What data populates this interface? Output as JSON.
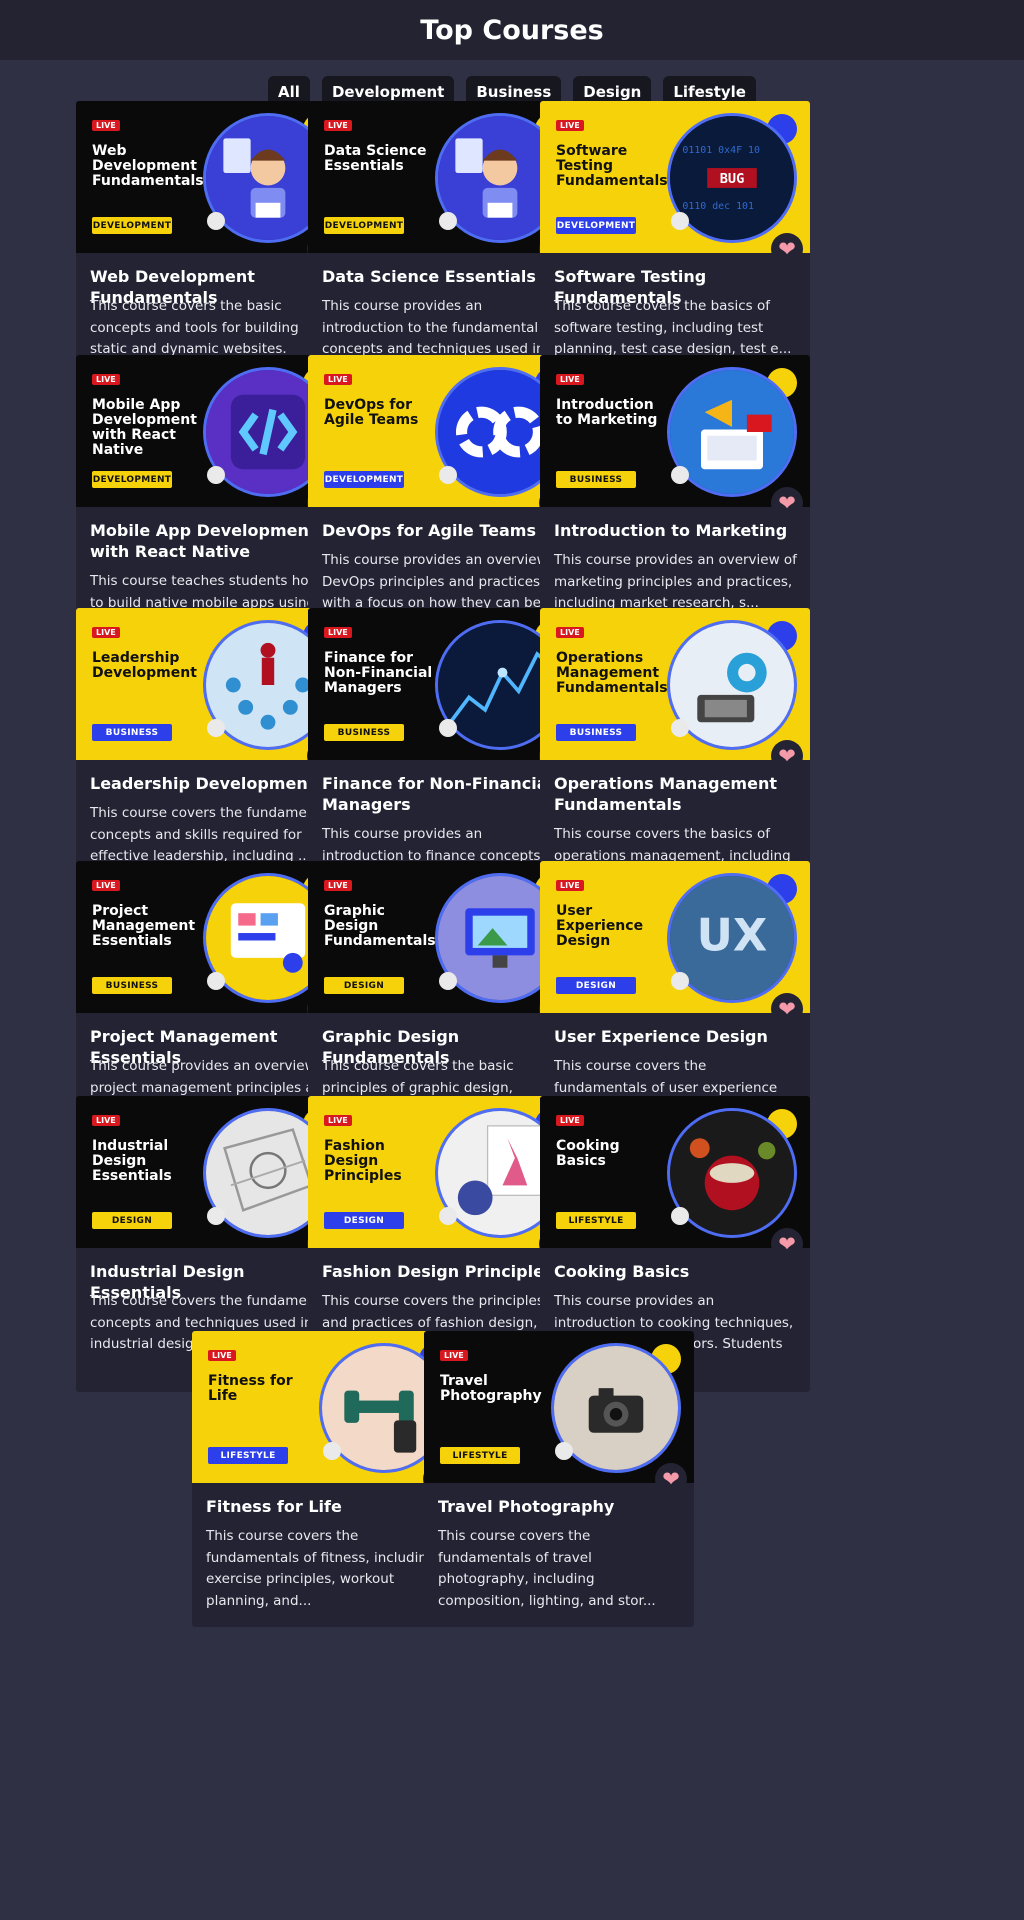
{
  "header": {
    "title": "Top Courses"
  },
  "filters": [
    "All",
    "Development",
    "Business",
    "Design",
    "Lifestyle"
  ],
  "live_label": "LIVE",
  "colors": {
    "yellow": "#f6d20a",
    "blue": "#2d3fea",
    "card_bg": "#232333",
    "page_bg": "#2f3044",
    "heart": "#f49aa8"
  },
  "courses": [
    {
      "banner_title": "Web Development Fundamentals",
      "tag": "DEVELOPMENT",
      "title": "Web Development Fundamentals",
      "description": "This course covers the basic concepts and tools for building static and dynamic websites. Students w...",
      "banner_theme": "dark",
      "image": "developer-illustration-icon"
    },
    {
      "banner_title": "Data Science Essentials",
      "tag": "DEVELOPMENT",
      "title": "Data Science Essentials",
      "description": "This course provides an introduction to the fundamental concepts and techniques used in data science...",
      "banner_theme": "dark",
      "image": "developer-illustration-icon"
    },
    {
      "banner_title": "Software Testing Fundamentals",
      "tag": "DEVELOPMENT",
      "title": "Software Testing Fundamentals",
      "description": "This course covers the basics of software testing, including test planning, test case design, test e...",
      "banner_theme": "yellow",
      "image": "bug-code-icon"
    },
    {
      "banner_title": "Mobile App Development with React Native",
      "tag": "DEVELOPMENT",
      "title": "Mobile App Development with React Native",
      "description": "This course teaches students how to build native mobile apps using the React Native framework. Stude...",
      "banner_theme": "dark",
      "image": "code-brackets-icon"
    },
    {
      "banner_title": "DevOps for Agile Teams",
      "tag": "DEVELOPMENT",
      "title": "DevOps for Agile Teams",
      "description": "This course provides an overview of DevOps principles and practices, with a focus on how they can be...",
      "banner_theme": "yellow",
      "image": "infinity-loop-icon"
    },
    {
      "banner_title": "Introduction to Marketing",
      "tag": "BUSINESS",
      "title": "Introduction to Marketing",
      "description": "This course provides an overview of marketing principles and practices, including market research, s...",
      "banner_theme": "dark",
      "image": "marketing-megaphone-icon"
    },
    {
      "banner_title": "Leadership Development",
      "tag": "BUSINESS",
      "title": "Leadership Development",
      "description": "This course covers the fundamental concepts and skills required for effective leadership, including ...",
      "banner_theme": "yellow",
      "image": "leader-crowd-icon"
    },
    {
      "banner_title": "Finance for Non-Financial Managers",
      "tag": "BUSINESS",
      "title": "Finance for Non-Financial Managers",
      "description": "This course provides an introduction to finance concepts and tools for non-financial managers. Stude...",
      "banner_theme": "dark",
      "image": "finance-chart-icon"
    },
    {
      "banner_title": "Operations Management Fundamentals",
      "tag": "BUSINESS",
      "title": "Operations Management Fundamentals",
      "description": "This course covers the basics of operations management, including process design, capacity planning,...",
      "banner_theme": "yellow",
      "image": "operations-gears-icon"
    },
    {
      "banner_title": "Project Management Essentials",
      "tag": "BUSINESS",
      "title": "Project Management Essentials",
      "description": "This course provides an overview of project management principles and techniques, including project ...",
      "banner_theme": "dark",
      "image": "project-board-icon"
    },
    {
      "banner_title": "Graphic Design Fundamentals",
      "tag": "DESIGN",
      "title": "Graphic Design Fundamentals",
      "description": "This course covers the basic principles of graphic design, including typography, color theory, layou...",
      "banner_theme": "dark",
      "image": "design-monitor-icon"
    },
    {
      "banner_title": "User Experience Design",
      "tag": "DESIGN",
      "title": "User Experience Design",
      "description": "This course covers the fundamentals of user experience (UX) design, including user research, interac...",
      "banner_theme": "yellow",
      "image": "ux-letters-icon"
    },
    {
      "banner_title": "Industrial Design Essentials",
      "tag": "DESIGN",
      "title": "Industrial Design Essentials",
      "description": "This course covers the fundamental concepts and techniques used in industrial design, including sket...",
      "banner_theme": "dark",
      "image": "blueprint-sketch-icon"
    },
    {
      "banner_title": "Fashion Design Principles",
      "tag": "DESIGN",
      "title": "Fashion Design Principles",
      "description": "This course covers the principles and practices of fashion design, including fashion illustration, t...",
      "banner_theme": "yellow",
      "image": "fashion-sketch-icon"
    },
    {
      "banner_title": "Cooking Basics",
      "tag": "LIFESTYLE",
      "title": "Cooking Basics",
      "description": "This course provides an introduction to cooking techniques, ingredients, and flavors. Students will ...",
      "banner_theme": "dark",
      "image": "cooking-pot-icon"
    },
    {
      "banner_title": "Fitness for Life",
      "tag": "LIFESTYLE",
      "title": "Fitness for Life",
      "description": "This course covers the fundamentals of fitness, including exercise principles, workout planning, and...",
      "banner_theme": "yellow",
      "image": "dumbbell-icon"
    },
    {
      "banner_title": "Travel Photography",
      "tag": "LIFESTYLE",
      "title": "Travel Photography",
      "description": "This course covers the fundamentals of travel photography, including composition, lighting, and stor...",
      "banner_theme": "dark",
      "image": "camera-icon"
    }
  ]
}
